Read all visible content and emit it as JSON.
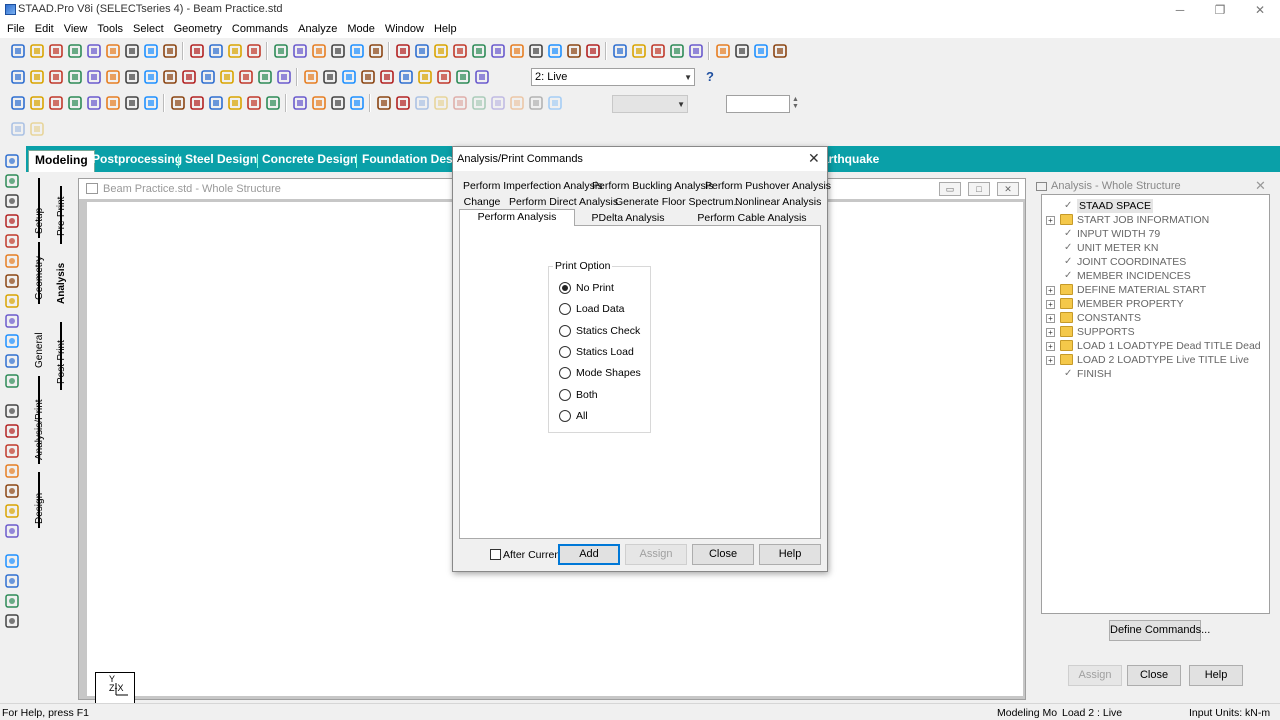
{
  "window": {
    "title": "STAAD.Pro V8i (SELECTseries 4) - Beam Practice.std"
  },
  "menu": [
    "File",
    "Edit",
    "View",
    "Tools",
    "Select",
    "Geometry",
    "Commands",
    "Analyze",
    "Mode",
    "Window",
    "Help"
  ],
  "toolbar": {
    "load_case_combo": "2: Live"
  },
  "page_tabs": [
    {
      "label": "Modeling",
      "active": true
    },
    {
      "label": "Postprocessing",
      "active": false
    },
    {
      "label": "Steel Design",
      "active": false
    },
    {
      "label": "Concrete Design",
      "active": false
    },
    {
      "label": "Foundation Desi",
      "active": false
    },
    {
      "label": "arthquake",
      "active": false
    }
  ],
  "sub_tabs": {
    "outer": [
      "Setup",
      "Geometry",
      "General",
      "Analysis/Print",
      "Design"
    ],
    "inner": [
      "Pre-Print",
      "Analysis",
      "Post-Print"
    ]
  },
  "view_window": {
    "title": "Beam Practice.std - Whole Structure",
    "axes_label": "Y\nZ-X"
  },
  "dialog": {
    "title": "Analysis/Print Commands",
    "tabs_row1": [
      "Perform Imperfection Analysis",
      "Perform Buckling Analysis",
      "Perform Pushover Analysis"
    ],
    "tabs_row2": [
      "Change",
      "Perform Direct Analysis",
      "Generate Floor Spectrum...",
      "Nonlinear Analysis"
    ],
    "tabs_row3": [
      "Perform Analysis",
      "PDelta Analysis",
      "Perform Cable Analysis"
    ],
    "active_tab": "Perform Analysis",
    "print_option": {
      "legend": "Print Option",
      "options": [
        "No Print",
        "Load Data",
        "Statics Check",
        "Statics Load",
        "Mode Shapes",
        "Both",
        "All"
      ],
      "selected": "No Print"
    },
    "after_current_label": "After Current",
    "after_current_checked": false,
    "buttons": {
      "add": "Add",
      "assign": "Assign",
      "close": "Close",
      "help": "Help"
    }
  },
  "right_panel": {
    "title": "Analysis - Whole Structure",
    "tree": [
      {
        "label": "STAAD SPACE",
        "type": "check",
        "selected": true
      },
      {
        "label": "START JOB INFORMATION",
        "type": "folder"
      },
      {
        "label": "INPUT WIDTH 79",
        "type": "check"
      },
      {
        "label": "UNIT METER KN",
        "type": "check"
      },
      {
        "label": "JOINT COORDINATES",
        "type": "check"
      },
      {
        "label": "MEMBER INCIDENCES",
        "type": "check"
      },
      {
        "label": "DEFINE MATERIAL START",
        "type": "folder"
      },
      {
        "label": "MEMBER PROPERTY",
        "type": "folder"
      },
      {
        "label": "CONSTANTS",
        "type": "folder"
      },
      {
        "label": "SUPPORTS",
        "type": "folder"
      },
      {
        "label": "LOAD 1 LOADTYPE Dead  TITLE Dead",
        "type": "folder"
      },
      {
        "label": "LOAD 2 LOADTYPE Live  TITLE Live",
        "type": "folder"
      },
      {
        "label": "FINISH",
        "type": "check"
      }
    ],
    "define_commands": "Define Commands...",
    "assign": "Assign",
    "close": "Close",
    "help": "Help"
  },
  "status": {
    "left": "For Help, press F1",
    "mode": "Modeling Mo",
    "load": "Load 2 : Live",
    "units": "Input Units:  kN-m"
  }
}
